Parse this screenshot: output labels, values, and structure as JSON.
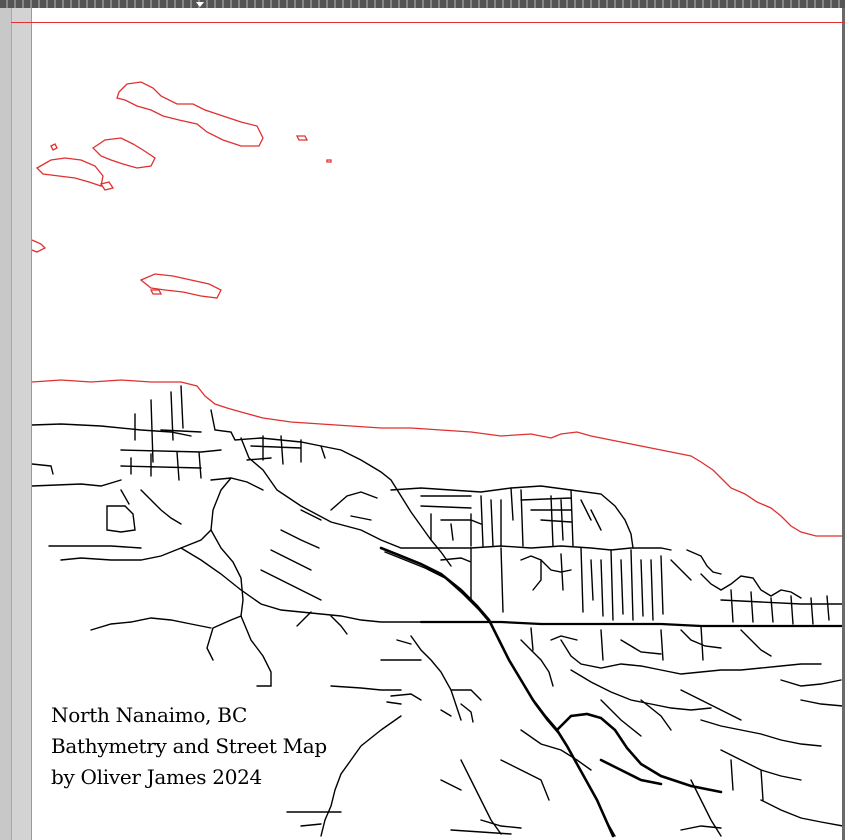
{
  "map": {
    "title_line1": "North Nanaimo, BC",
    "title_line2": "Bathymetry and Street Map",
    "title_line3": "by Oliver James 2024"
  },
  "colors": {
    "bathymetry_contour": "#e03030",
    "streets": "#000000",
    "page": "#ffffff",
    "pasteboard": "#d3d3d3"
  }
}
